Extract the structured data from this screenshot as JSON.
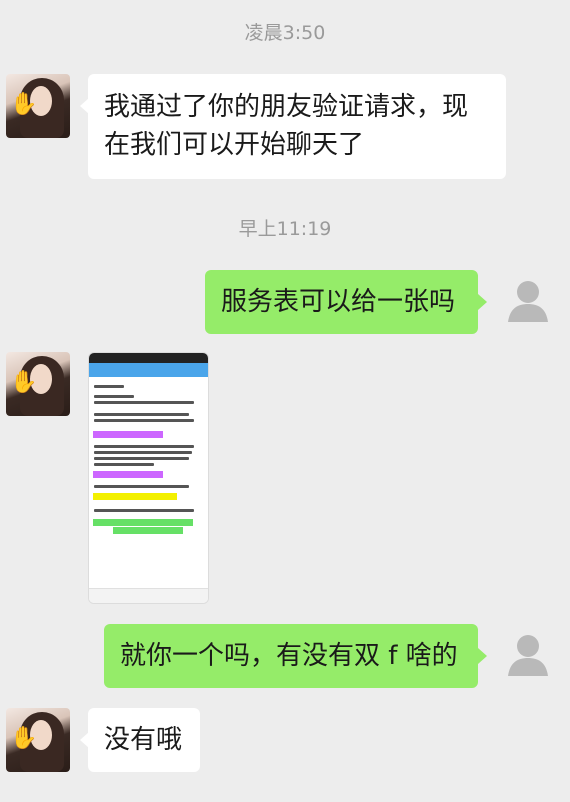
{
  "timestamps": [
    "凌晨3:50",
    "早上11:19"
  ],
  "messages": [
    {
      "side": "left",
      "line1": "我通过了你的朋友验证请求，现",
      "line2": "在我们可以开始聊天了"
    },
    {
      "side": "right",
      "text": "服务表可以给一张吗"
    },
    {
      "side": "left",
      "type": "image",
      "description_icon": "image-thumbnail"
    },
    {
      "side": "right",
      "text": "就你一个吗，有没有双 f 啥的"
    },
    {
      "side": "left",
      "text": "没有哦"
    }
  ],
  "colors": {
    "background": "#ededed",
    "incoming_bubble": "#ffffff",
    "outgoing_bubble": "#95ec69",
    "timestamp": "#9a9a9a"
  },
  "icons": {
    "self_avatar": "default-user-icon",
    "contact_avatar": "contact-avatar"
  }
}
